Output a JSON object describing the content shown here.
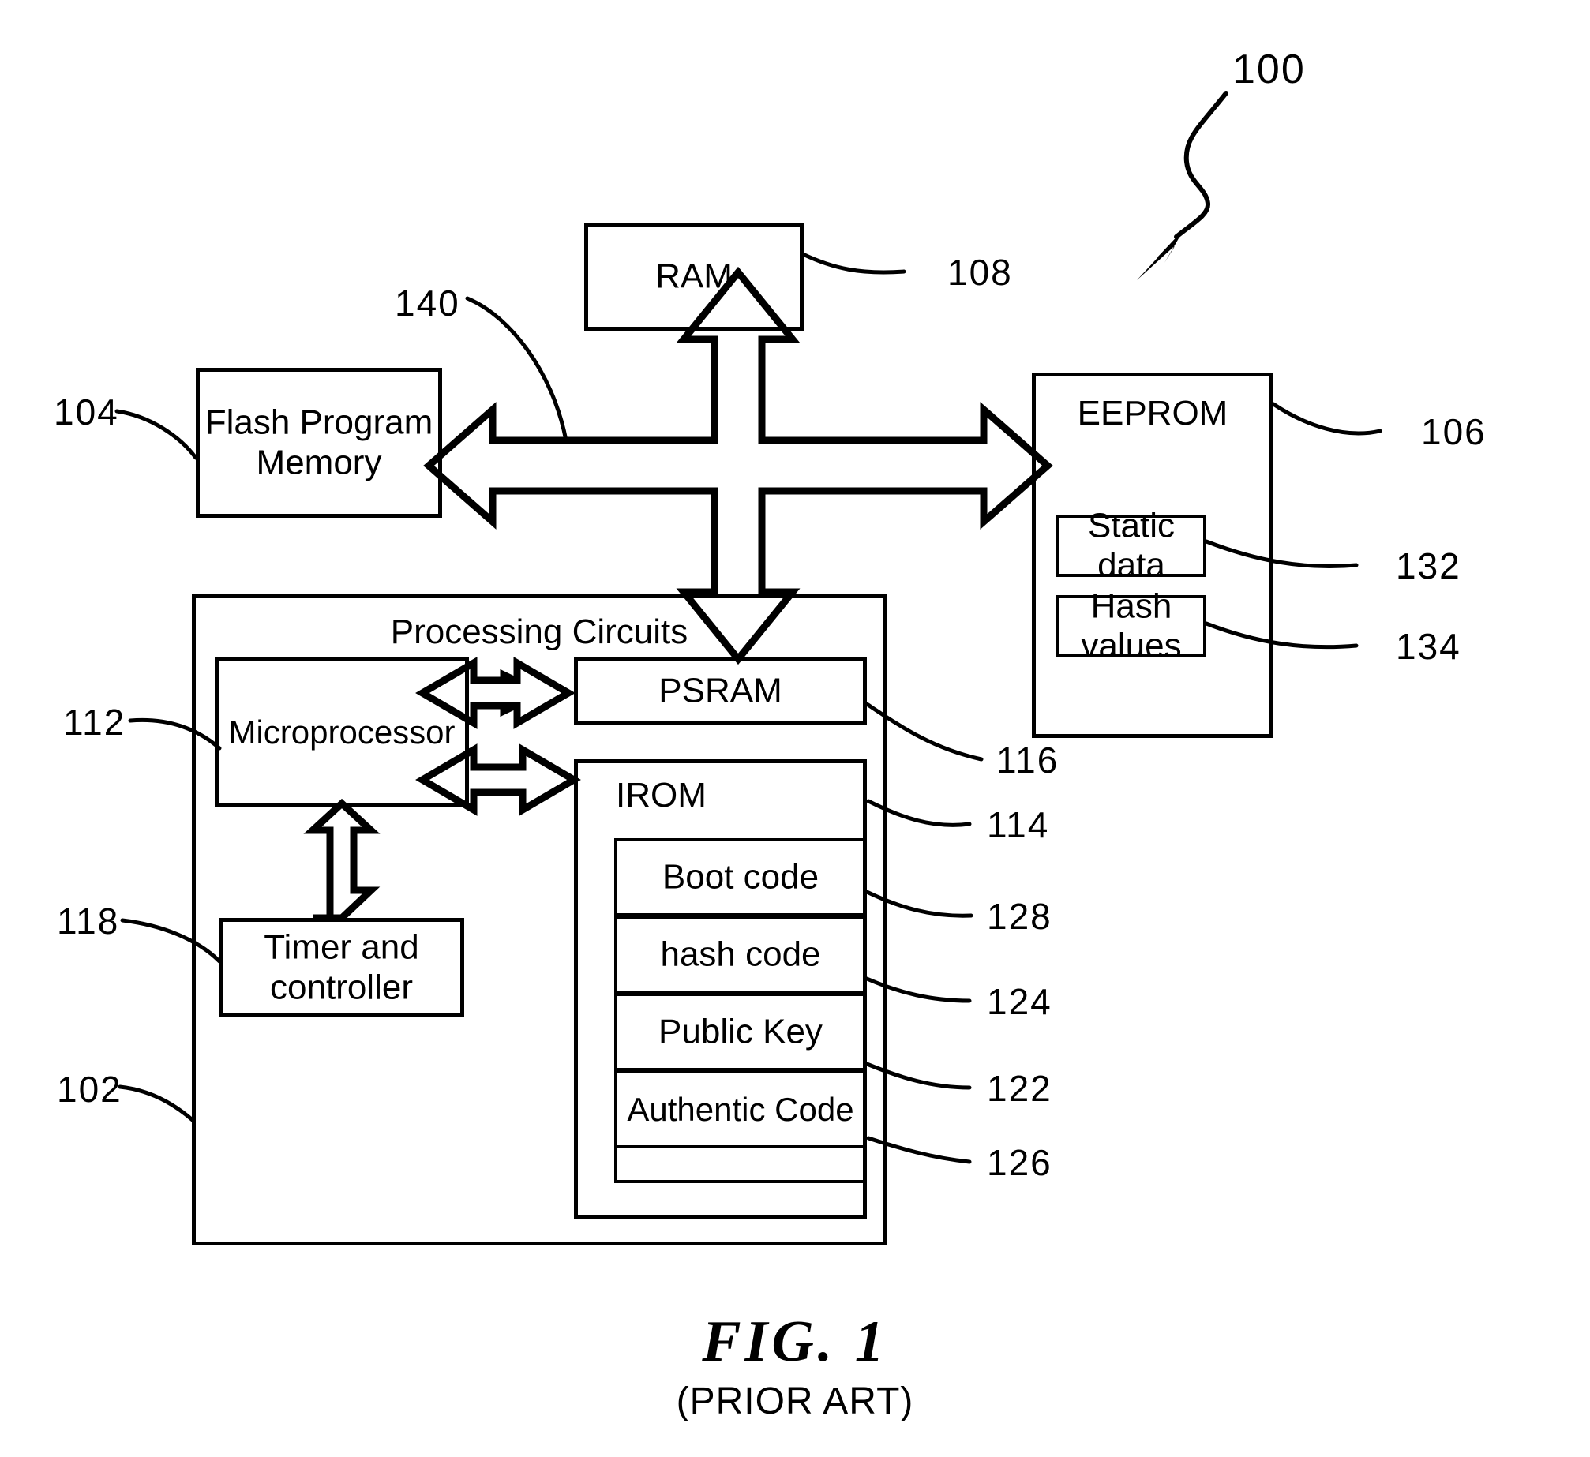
{
  "figure": {
    "title": "FIG.  1",
    "subtitle": "(PRIOR ART)",
    "system_ref": "100"
  },
  "blocks": {
    "ram": {
      "label": "RAM",
      "ref": "108"
    },
    "flash": {
      "label": "Flash  Program\nMemory",
      "line1": "Flash  Program",
      "line2": "Memory",
      "ref": "104"
    },
    "eeprom": {
      "label": "EEPROM",
      "ref": "106"
    },
    "static_data": {
      "label": "Static  data",
      "ref": "132"
    },
    "hash_values": {
      "label": "Hash  values",
      "ref": "134"
    },
    "processing_circuits": {
      "label": "Processing  Circuits",
      "ref": "102"
    },
    "microprocessor": {
      "label": "Microprocessor",
      "ref": "112"
    },
    "psram": {
      "label": "PSRAM",
      "ref": "116"
    },
    "irom": {
      "label": "IROM",
      "ref": "114"
    },
    "boot_code": {
      "label": "Boot  code",
      "ref": "128"
    },
    "hash_code": {
      "label": "hash  code",
      "ref": "124"
    },
    "public_key": {
      "label": "Public  Key",
      "ref": "122"
    },
    "authentic_code": {
      "label": "Authentic  Code",
      "ref": "126"
    },
    "timer_controller": {
      "label": "Timer  and\ncontroller",
      "line1": "Timer  and",
      "line2": "controller",
      "ref": "118"
    },
    "bus": {
      "ref": "140"
    }
  },
  "colors": {
    "ink": "#000000",
    "paper": "#ffffff"
  }
}
